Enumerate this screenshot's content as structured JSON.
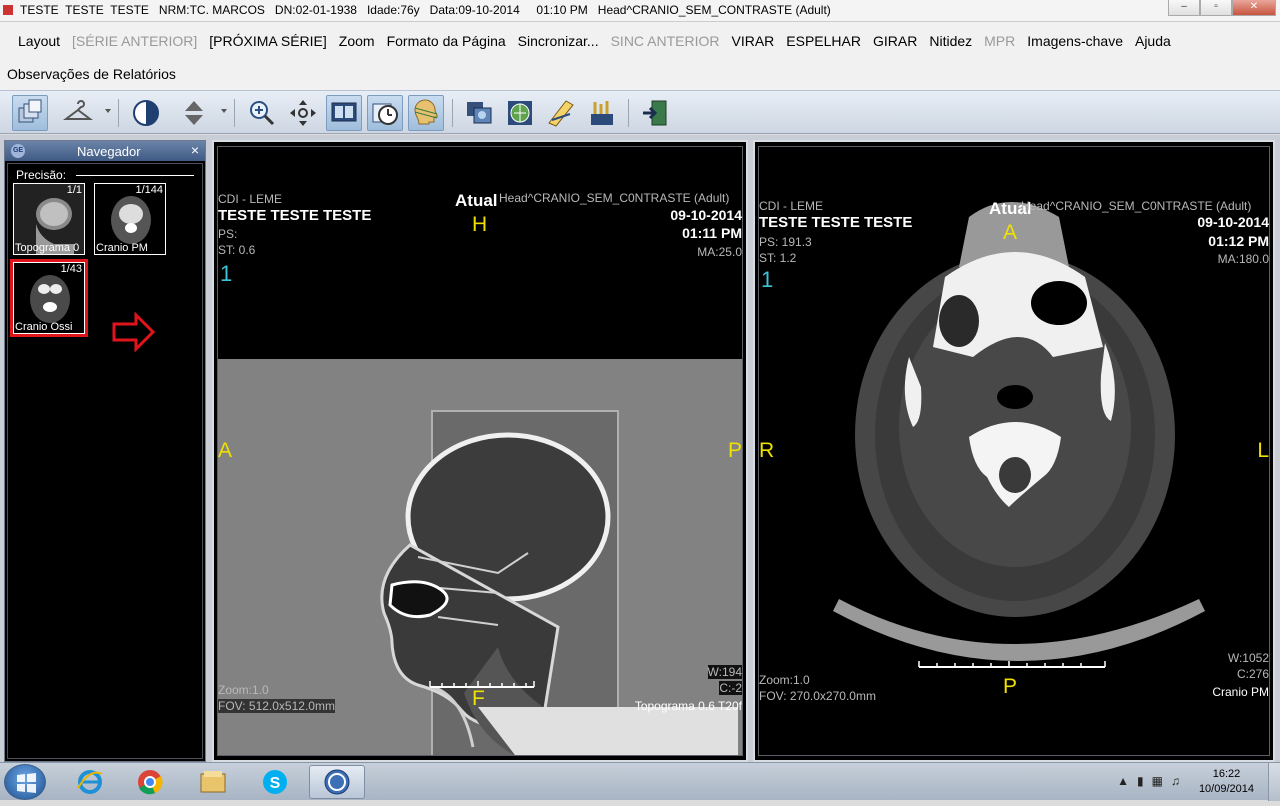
{
  "window": {
    "title": "TESTE  TESTE  TESTE   NRM:TC. MARCOS   DN:02-01-1938   Idade:76y   Data:09-10-2014     01:10 PM   Head^CRANIO_SEM_CONTRASTE (Adult)"
  },
  "menu": {
    "row1": [
      {
        "label": "Layout",
        "enabled": true
      },
      {
        "label": "[SÉRIE ANTERIOR]",
        "enabled": false
      },
      {
        "label": "[PRÓXIMA SÉRIE]",
        "enabled": true
      },
      {
        "label": "Zoom",
        "enabled": true
      },
      {
        "label": "Formato da Página",
        "enabled": true
      },
      {
        "label": "Sincronizar...",
        "enabled": true
      },
      {
        "label": "SINC ANTERIOR",
        "enabled": false
      },
      {
        "label": "VIRAR",
        "enabled": true
      },
      {
        "label": "ESPELHAR",
        "enabled": true
      },
      {
        "label": "GIRAR",
        "enabled": true
      },
      {
        "label": "Nitidez",
        "enabled": true
      },
      {
        "label": "MPR",
        "enabled": false
      },
      {
        "label": "Imagens-chave",
        "enabled": true
      },
      {
        "label": "Ajuda",
        "enabled": true
      }
    ],
    "row2": [
      {
        "label": "Observações de Relatórios",
        "enabled": true
      }
    ]
  },
  "toolbar": {
    "icons": [
      "layers-icon",
      "hanger-icon",
      "contrast-icon",
      "scroll-icon",
      "zoom-icon",
      "pan-icon",
      "monitor-layout-icon",
      "stopwatch-icon",
      "head-3d-icon",
      "print-series-icon",
      "globe-export-icon",
      "measure-icon",
      "annotation-tools-icon",
      "exit-icon"
    ]
  },
  "navigator": {
    "title": "Navegador",
    "close": "×",
    "logo": "GE",
    "precision_label": "Precisão:",
    "thumbnails": [
      {
        "count": "1/1",
        "label": "Topograma  0"
      },
      {
        "count": "1/144",
        "label": "Cranio  PM"
      },
      {
        "count": "1/43",
        "label": "Cranio  Ossi",
        "highlighted": true
      }
    ]
  },
  "viewport_left": {
    "institution": "CDI - LEME",
    "patient": "TESTE  TESTE  TESTE",
    "ps": "PS:",
    "st": "ST: 0.6",
    "image_number": "1",
    "atual": "Atual",
    "series_desc": "Head^CRANIO_SEM_C0NTRASTE (Adult)",
    "date": "09-10-2014",
    "time": "01:11 PM",
    "ma": "MA:25.0",
    "orient_top": "H",
    "orient_left": "A",
    "orient_right": "P",
    "orient_bottom": "F",
    "zoom": "Zoom:1.0",
    "fov": "FOV: 512.0x512.0mm",
    "window_w": "W:194",
    "window_c": "C:-2",
    "series_label": "Topograma  0.6  T20f"
  },
  "viewport_right": {
    "institution": "CDI - LEME",
    "patient": "TESTE  TESTE  TESTE",
    "ps": "PS: 191.3",
    "st": "ST: 1.2",
    "image_number": "1",
    "atual": "Atual",
    "series_desc": "Head^CRANIO_SEM_C0NTRASTE (Adult)",
    "date": "09-10-2014",
    "time": "01:12 PM",
    "ma": "MA:180.0",
    "orient_top": "A",
    "orient_left": "R",
    "orient_right": "L",
    "orient_bottom": "P",
    "zoom": "Zoom:1.0",
    "fov": "FOV: 270.0x270.0mm",
    "window_w": "W:1052",
    "window_c": "C:276",
    "series_label": "Cranio  PM"
  },
  "taskbar": {
    "apps": [
      "ie-icon",
      "chrome-icon",
      "explorer-icon",
      "skype-icon",
      "ge-app-icon"
    ],
    "time": "16:22",
    "date": "10/09/2014"
  }
}
